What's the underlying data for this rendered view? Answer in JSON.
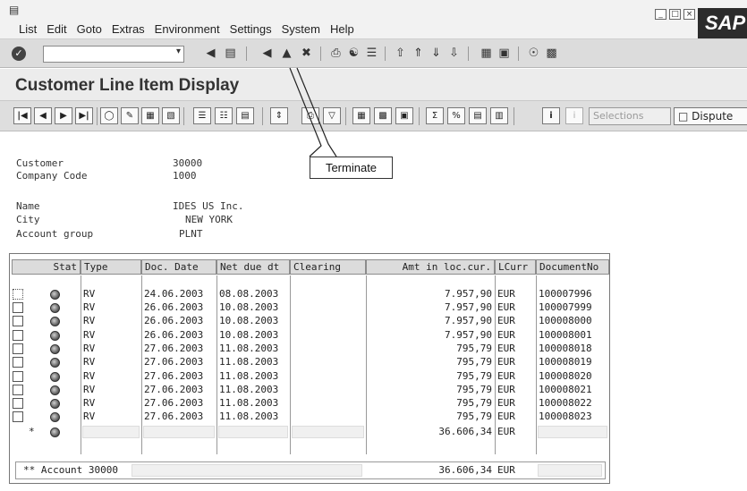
{
  "menu": {
    "items": [
      "List",
      "Edit",
      "Goto",
      "Extras",
      "Environment",
      "Settings",
      "System",
      "Help"
    ]
  },
  "logo": "SAP",
  "window_controls": [
    "minimize-icon",
    "maximize-icon",
    "close-icon"
  ],
  "title": "Customer Line Item Display",
  "app_toolbar": {
    "selections_label": "Selections",
    "dispute_label": "Dispute"
  },
  "callout": "Terminate",
  "header": {
    "customer_label": "Customer",
    "customer_value": "30000",
    "company_code_label": "Company Code",
    "company_code_value": "1000",
    "name_label": "Name",
    "name_value": "IDES US Inc.",
    "city_label": "City",
    "city_value": "NEW YORK",
    "account_group_label": "Account group",
    "account_group_value": "PLNT"
  },
  "table": {
    "columns": [
      "Stat",
      "Type",
      "Doc. Date",
      "Net due dt",
      "Clearing",
      "Amt in loc.cur.",
      "LCurr",
      "DocumentNo"
    ],
    "rows": [
      {
        "type": "RV",
        "doc_date": "24.06.2003",
        "net_due": "08.08.2003",
        "amount": "7.957,90",
        "curr": "EUR",
        "doc_no": "100007996"
      },
      {
        "type": "RV",
        "doc_date": "26.06.2003",
        "net_due": "10.08.2003",
        "amount": "7.957,90",
        "curr": "EUR",
        "doc_no": "100007999"
      },
      {
        "type": "RV",
        "doc_date": "26.06.2003",
        "net_due": "10.08.2003",
        "amount": "7.957,90",
        "curr": "EUR",
        "doc_no": "100008000"
      },
      {
        "type": "RV",
        "doc_date": "26.06.2003",
        "net_due": "10.08.2003",
        "amount": "7.957,90",
        "curr": "EUR",
        "doc_no": "100008001"
      },
      {
        "type": "RV",
        "doc_date": "27.06.2003",
        "net_due": "11.08.2003",
        "amount": "795,79",
        "curr": "EUR",
        "doc_no": "100008018"
      },
      {
        "type": "RV",
        "doc_date": "27.06.2003",
        "net_due": "11.08.2003",
        "amount": "795,79",
        "curr": "EUR",
        "doc_no": "100008019"
      },
      {
        "type": "RV",
        "doc_date": "27.06.2003",
        "net_due": "11.08.2003",
        "amount": "795,79",
        "curr": "EUR",
        "doc_no": "100008020"
      },
      {
        "type": "RV",
        "doc_date": "27.06.2003",
        "net_due": "11.08.2003",
        "amount": "795,79",
        "curr": "EUR",
        "doc_no": "100008021"
      },
      {
        "type": "RV",
        "doc_date": "27.06.2003",
        "net_due": "11.08.2003",
        "amount": "795,79",
        "curr": "EUR",
        "doc_no": "100008022"
      },
      {
        "type": "RV",
        "doc_date": "27.06.2003",
        "net_due": "11.08.2003",
        "amount": "795,79",
        "curr": "EUR",
        "doc_no": "100008023"
      }
    ],
    "subtotal": {
      "marker": "*",
      "amount": "36.606,34",
      "curr": "EUR"
    },
    "total": {
      "label": "** Account 30000",
      "amount": "36.606,34",
      "curr": "EUR"
    }
  }
}
